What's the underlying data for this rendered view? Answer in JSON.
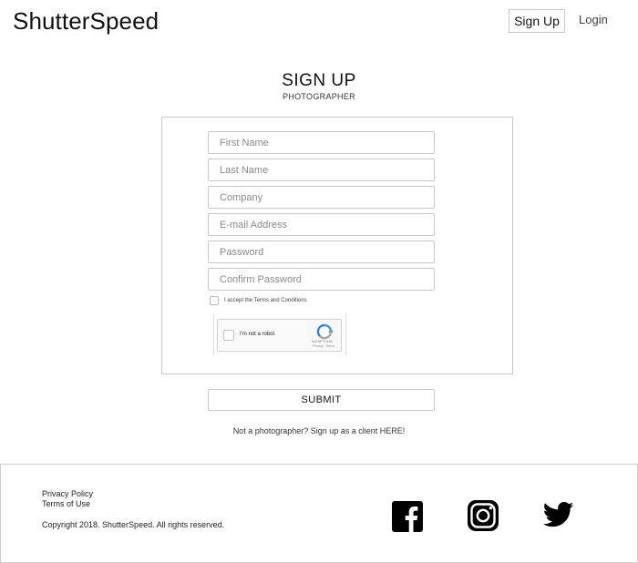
{
  "header": {
    "brand": "ShutterSpeed",
    "signup_label": "Sign Up",
    "login_label": "Login"
  },
  "main": {
    "title": "SIGN UP",
    "subtitle": "PHOTOGRAPHER",
    "fields": {
      "first_name": {
        "placeholder": "First Name",
        "value": ""
      },
      "last_name": {
        "placeholder": "Last Name",
        "value": ""
      },
      "company": {
        "placeholder": "Company",
        "value": ""
      },
      "email": {
        "placeholder": "E-mail Address",
        "value": ""
      },
      "password": {
        "placeholder": "Password",
        "value": ""
      },
      "confirm_password": {
        "placeholder": "Confirm Password",
        "value": ""
      }
    },
    "terms": {
      "label": "I accept the Terms and Conditions",
      "checked": false
    },
    "recaptcha": {
      "label": "I'm not a robot",
      "brand": "reCAPTCHA",
      "links": "Privacy - Terms",
      "checked": false
    },
    "submit_label": "SUBMIT",
    "client_link": "Not a photographer? Sign up as a client HERE!"
  },
  "footer": {
    "privacy": "Privacy Policy",
    "terms": "Terms of Use",
    "copyright": "Copyright 2018. ShutterSpeed. All rights reserved.",
    "social": [
      "facebook-icon",
      "instagram-icon",
      "twitter-icon"
    ]
  },
  "colors": {
    "text": "#111111",
    "border": "#c9c9c9",
    "recaptcha_blue": "#4a90e2",
    "recaptcha_grey": "#a6a6a6",
    "social_black": "#000000"
  }
}
